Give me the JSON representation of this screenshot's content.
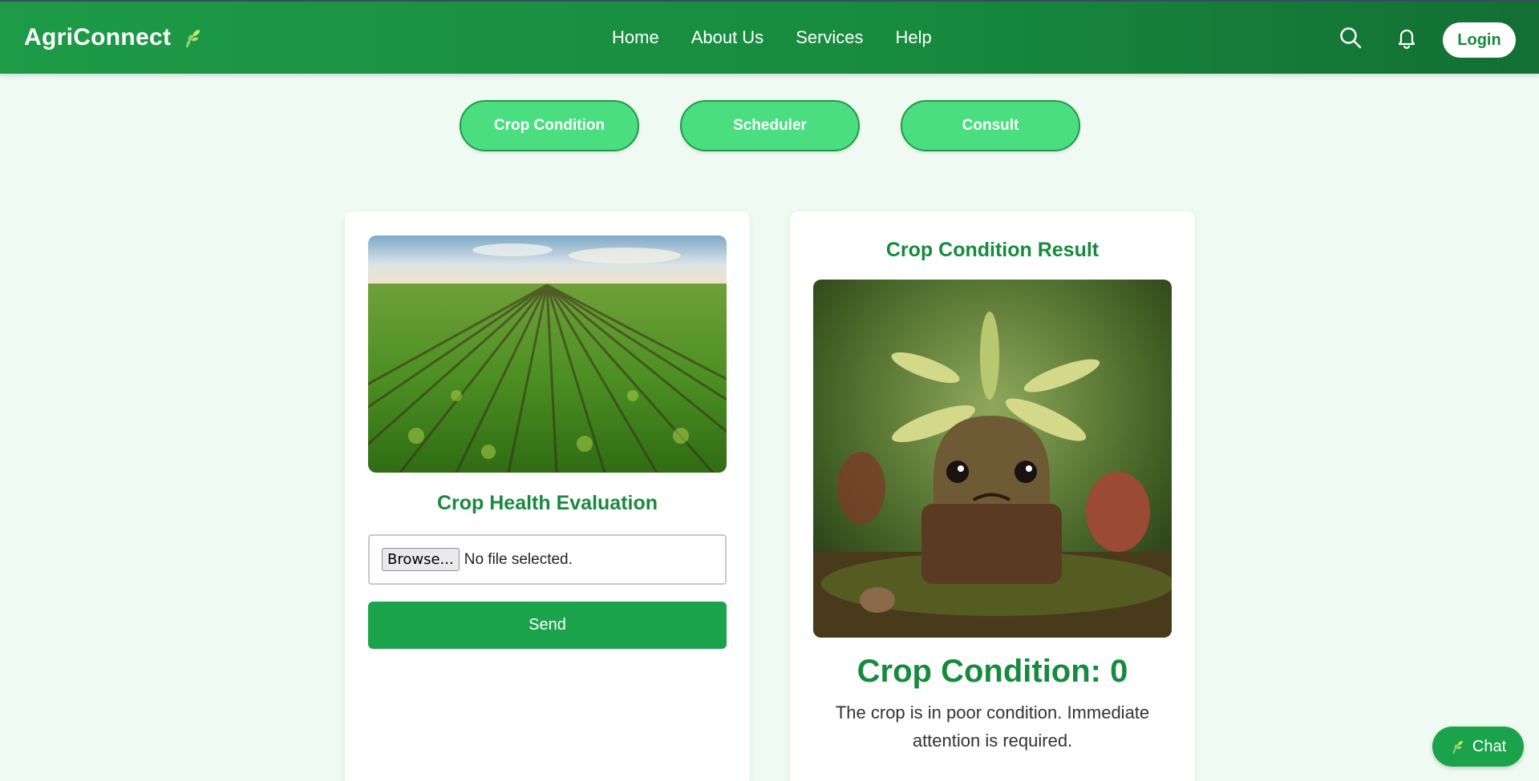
{
  "brand": {
    "name": "AgriConnect",
    "icon": "leaf-sprout-icon"
  },
  "nav": {
    "items": [
      "Home",
      "About Us",
      "Services",
      "Help"
    ]
  },
  "header_actions": {
    "search_icon": "search-icon",
    "bell_icon": "bell-icon",
    "login_label": "Login"
  },
  "tabs": [
    "Crop Condition",
    "Scheduler",
    "Consult"
  ],
  "evaluation": {
    "title": "Crop Health Evaluation",
    "browse_label": "Browse...",
    "file_status": "No file selected.",
    "send_label": "Send"
  },
  "result": {
    "title": "Crop Condition Result",
    "value": "Crop Condition: 0",
    "message": "The crop is in poor condition. Immediate attention is required."
  },
  "chat": {
    "label": "Chat"
  },
  "colors": {
    "brand_green": "#178a3e",
    "tab_green": "#4ade80",
    "button_green": "#1aa34a",
    "background": "#effbf2"
  }
}
